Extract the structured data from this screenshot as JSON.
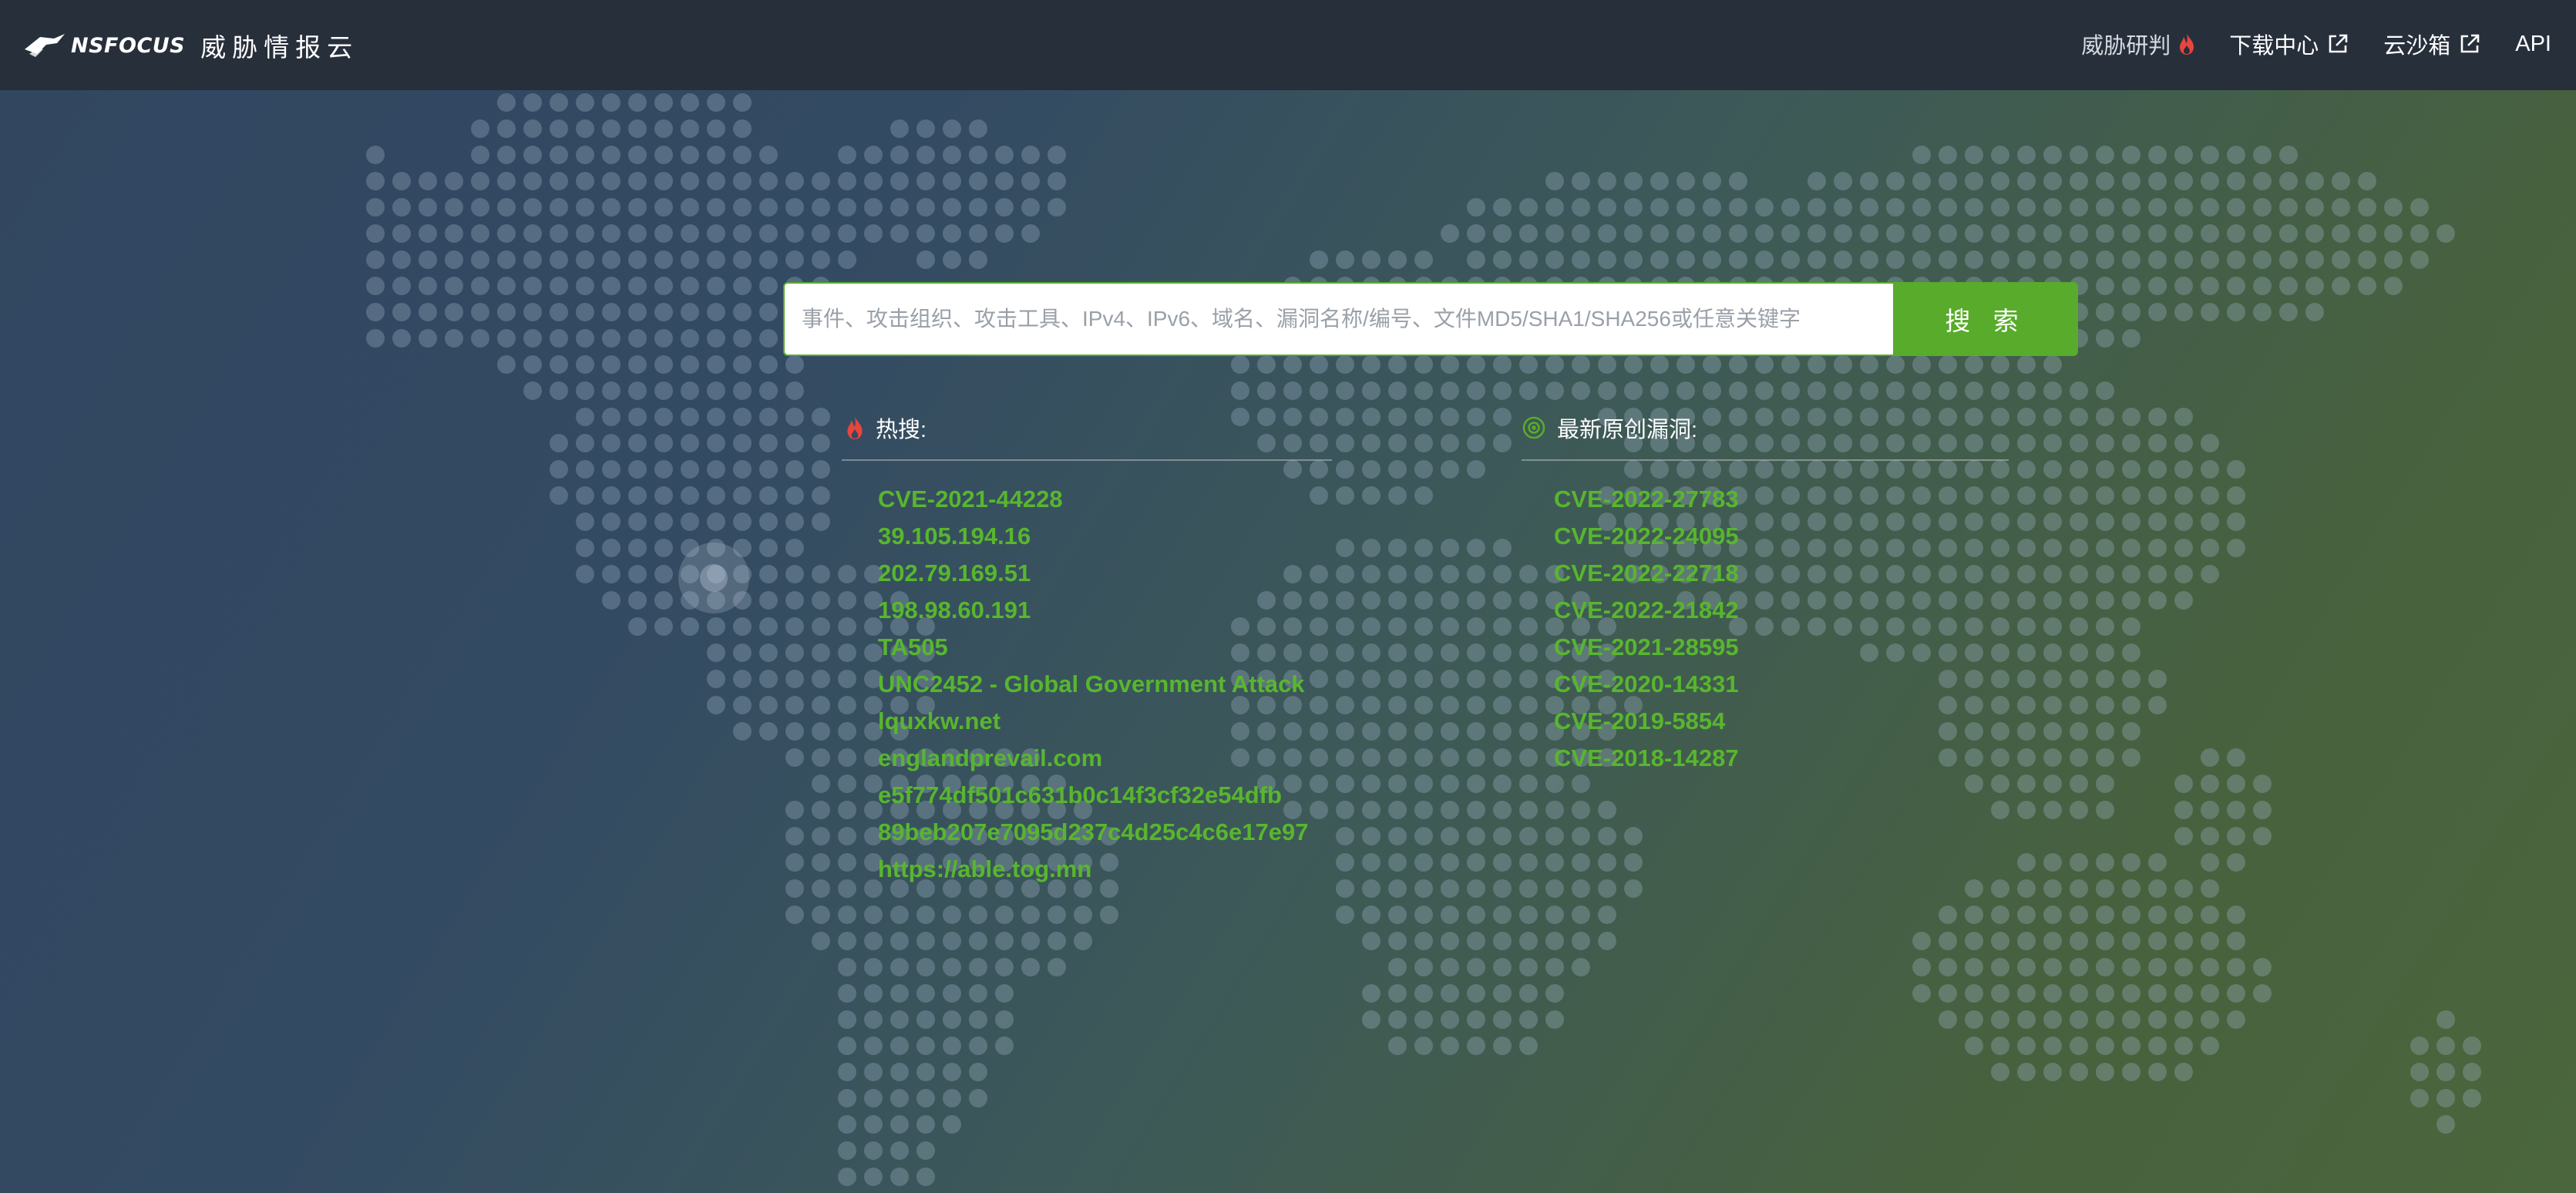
{
  "header": {
    "logo_text": "NSFOCUS",
    "product_name": "威胁情报云",
    "nav": [
      {
        "label": "威胁研判",
        "icon": "flame-icon"
      },
      {
        "label": "下载中心",
        "icon": "external-link-icon"
      },
      {
        "label": "云沙箱",
        "icon": "external-link-icon"
      },
      {
        "label": "API"
      }
    ]
  },
  "search": {
    "placeholder": "事件、攻击组织、攻击工具、IPv4、IPv6、域名、漏洞名称/编号、文件MD5/SHA1/SHA256或任意关键字",
    "value": "",
    "button_label": "搜 索"
  },
  "hot": {
    "title": "热搜:",
    "icon": "flame-icon",
    "items": [
      "CVE-2021-44228",
      "39.105.194.16",
      "202.79.169.51",
      "198.98.60.191",
      "TA505",
      "UNC2452 - Global Government Attack",
      "lquxkw.net",
      "englandprevail.com",
      "e5f774df501c631b0c14f3cf32e54dfb",
      "89beb207e7095d237c4d25c4c6e17e97",
      "https://able.tog.mn"
    ]
  },
  "vuln": {
    "title": "最新原创漏洞:",
    "icon": "target-icon",
    "items": [
      "CVE-2022-27783",
      "CVE-2022-24095",
      "CVE-2022-22718",
      "CVE-2022-21842",
      "CVE-2021-28595",
      "CVE-2020-14331",
      "CVE-2019-5854",
      "CVE-2018-14287"
    ]
  },
  "colors": {
    "topbar": "#272f3b",
    "accent_green": "#58ab2b",
    "link_green": "#58b62e",
    "flame": "#e8453c"
  }
}
